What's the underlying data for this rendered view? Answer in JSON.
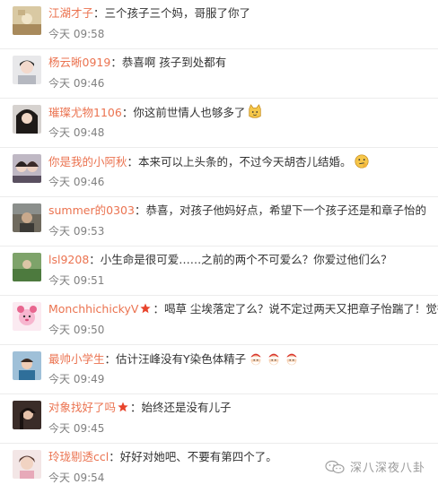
{
  "colors": {
    "username": "#eb7350",
    "time": "#808080",
    "text": "#333333",
    "divider": "#ececec"
  },
  "comments": [
    {
      "user": "江湖才子",
      "sep": "：",
      "text": "三个孩子三个妈，哥服了你了",
      "time": "今天 09:58"
    },
    {
      "user": "杨云晰0919",
      "sep": "：",
      "text": "恭喜啊 孩子到处都有",
      "time": "今天 09:46"
    },
    {
      "user": "璀璨尤物1106",
      "sep": "：",
      "text": "你这前世情人也够多了",
      "time": "今天 09:48"
    },
    {
      "user": "你是我的小阿秋",
      "sep": "：",
      "text": "本来可以上头条的，不过今天胡杏儿结婚。",
      "time": "今天 09:46"
    },
    {
      "user": "summer的0303",
      "sep": "：",
      "text": "恭喜，对孩子他妈好点，希望下一个孩子还是和章子怡的",
      "time": "今天 09:53"
    },
    {
      "user": "lsl9208",
      "sep": "：",
      "text": "小生命是很可爱……之前的两个不可爱么？你爱过他们么？",
      "time": "今天 09:51"
    },
    {
      "user": "MonchhichickyV",
      "sep": "：",
      "text": "喝草 尘埃落定了么？说不定过两天又把章子怡踹了！觉得对",
      "time": "今天 09:50"
    },
    {
      "user": "最帅小学生",
      "sep": "：",
      "text": "估计汪峰没有Y染色体精子",
      "time": "今天 09:49"
    },
    {
      "user": "对象找好了吗",
      "sep": "：",
      "text": "始终还是没有儿子",
      "time": "今天 09:45"
    },
    {
      "user": "玲珑剔透ccl",
      "sep": "：",
      "text": "好好对她吧、不要有第四个了。",
      "time": "今天 09:54"
    }
  ],
  "icons": {
    "emoji_cat": "cat-emoji-icon",
    "emoji_thinking": "thinking-emoji-icon",
    "emoji_santa": "santa-emoji-icon",
    "vip_badge": "star-badge-icon"
  },
  "watermark": {
    "text": "深八深夜八卦"
  }
}
